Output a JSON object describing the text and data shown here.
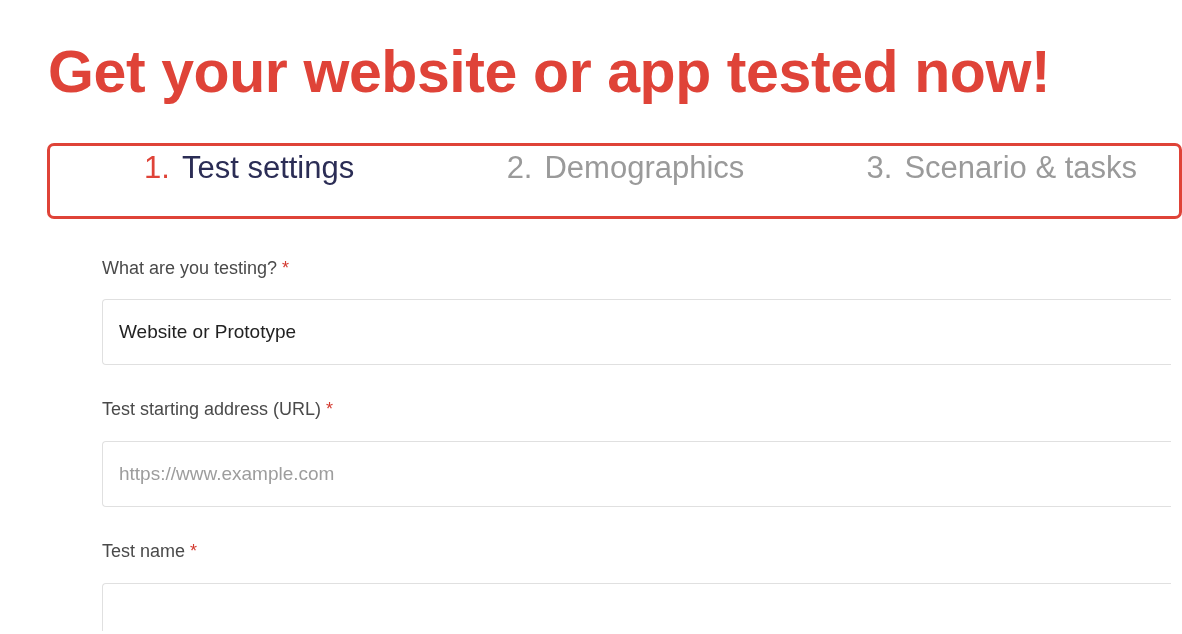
{
  "heading": "Get your website or app tested now!",
  "steps": [
    {
      "number": "1.",
      "label": "Test settings",
      "selected": true
    },
    {
      "number": "2.",
      "label": "Demographics",
      "selected": false
    },
    {
      "number": "3.",
      "label": "Scenario & tasks",
      "selected": false
    }
  ],
  "fields": [
    {
      "label": "What are you testing?",
      "required_mark": "*",
      "value": "Website or Prototype"
    },
    {
      "label": "Test starting address (URL)",
      "required_mark": "*",
      "placeholder": "https://www.example.com"
    },
    {
      "label": "Test name",
      "required_mark": "*"
    }
  ]
}
